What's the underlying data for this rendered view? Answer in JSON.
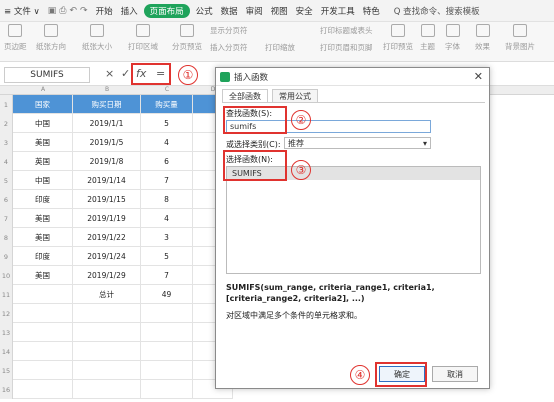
{
  "ribbon": {
    "file_menu": "≡ 文件 ∨",
    "tabs": [
      "开始",
      "插入",
      "页面布局",
      "公式",
      "数据",
      "审阅",
      "视图",
      "安全",
      "开发工具",
      "特色"
    ],
    "active_tab_index": 2,
    "search_label": "Q 查找命令、搜索模板",
    "accent_color": "#1fa35b"
  },
  "toolbar": {
    "items": [
      "页边距",
      "纸张方向",
      "纸张大小",
      "打印区域",
      "分页预览",
      "显示分页符",
      "插入分页符",
      "打印缩放",
      "打印标题或表头",
      "打印页眉和页脚",
      "打印预览",
      "主题",
      "字体",
      "效果",
      "背景图片"
    ]
  },
  "formula_bar": {
    "name_box": "SUMIFS",
    "cancel_symbol": "×",
    "confirm_symbol": "✓",
    "fx_label": "fx",
    "formula_value": "="
  },
  "annotations": {
    "circle_1": "①",
    "circle_2": "②",
    "circle_3": "③",
    "circle_4": "④",
    "color": "#e0332f"
  },
  "sheet": {
    "columns": [
      "A",
      "B",
      "C",
      "D"
    ],
    "header_row": [
      "国家",
      "购买日期",
      "购买量",
      ""
    ],
    "rows": [
      [
        "中国",
        "2019/1/1",
        "5"
      ],
      [
        "美国",
        "2019/1/5",
        "4"
      ],
      [
        "英国",
        "2019/1/8",
        "6"
      ],
      [
        "中国",
        "2019/1/14",
        "7"
      ],
      [
        "印度",
        "2019/1/15",
        "8"
      ],
      [
        "美国",
        "2019/1/19",
        "4"
      ],
      [
        "美国",
        "2019/1/22",
        "3"
      ],
      [
        "印度",
        "2019/1/24",
        "5"
      ],
      [
        "美国",
        "2019/1/29",
        "7"
      ],
      [
        "",
        "总计",
        "49"
      ]
    ],
    "row_numbers": [
      "1",
      "2",
      "3",
      "4",
      "5",
      "6",
      "7",
      "8",
      "9",
      "10",
      "11",
      "12",
      "13",
      "14",
      "15",
      "16"
    ],
    "header_color": "#4e93d6"
  },
  "dialog": {
    "title": "插入函数",
    "tabs": [
      "全部函数",
      "常用公式"
    ],
    "search_label": "查找函数(S):",
    "search_value": "sumifs",
    "category_label": "或选择类别(C):",
    "category_value": "推荐",
    "select_label": "选择函数(N):",
    "functions": [
      "SUMIFS"
    ],
    "signature": "SUMIFS(sum_range, criteria_range1, criteria1, [criteria_range2, criteria2], ...)",
    "description": "对区域中满足多个条件的单元格求和。",
    "ok_label": "确定",
    "cancel_label": "取消"
  }
}
